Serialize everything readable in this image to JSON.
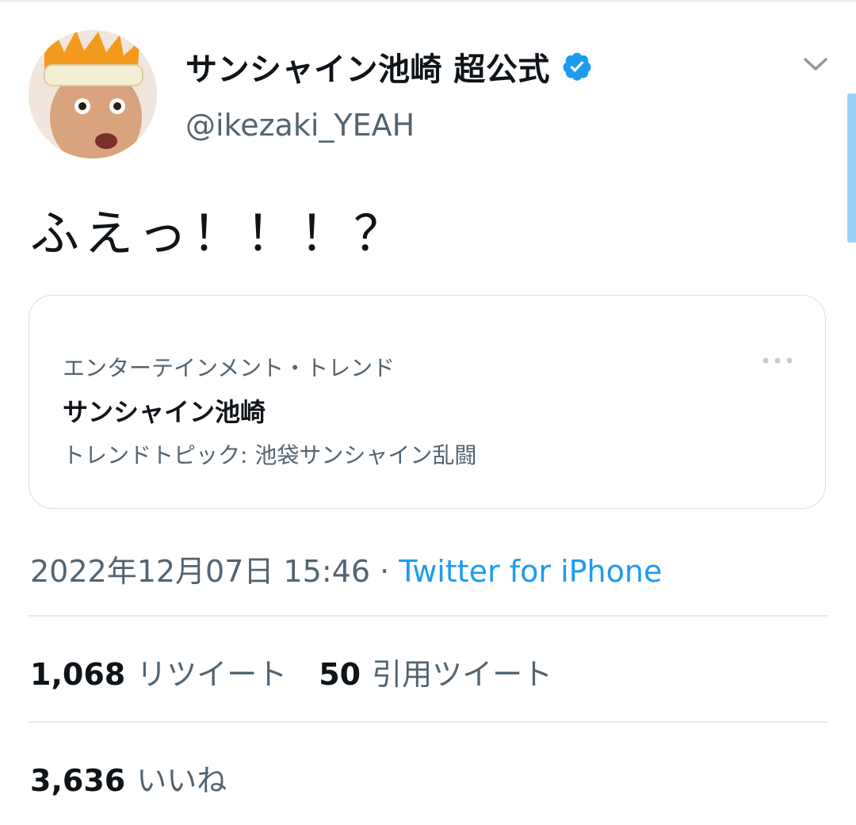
{
  "tweet": {
    "author": {
      "display_name": "サンシャイン池崎 超公式",
      "handle": "@ikezaki_YEAH",
      "verified": true
    },
    "text": "ふえっ！！！？",
    "card": {
      "category": "エンターテインメント・トレンド",
      "title": "サンシャイン池崎",
      "topic": "トレンドトピック: 池袋サンシャイン乱闘"
    },
    "meta": {
      "date": "2022年12月07日 15:46",
      "separator": "·",
      "source": "Twitter for iPhone"
    },
    "stats": {
      "retweets_count": "1,068",
      "retweets_label": "リツイート",
      "quotes_count": "50",
      "quotes_label": "引用ツイート",
      "likes_count": "3,636",
      "likes_label": "いいね"
    }
  },
  "colors": {
    "link": "#1d9bf0",
    "secondary_text": "#536471",
    "verified_badge": "#1d9bf0"
  },
  "icons": {
    "verified": "verified-badge-icon",
    "menu": "chevron-down-icon",
    "card_menu": "more-horizontal-icon"
  }
}
